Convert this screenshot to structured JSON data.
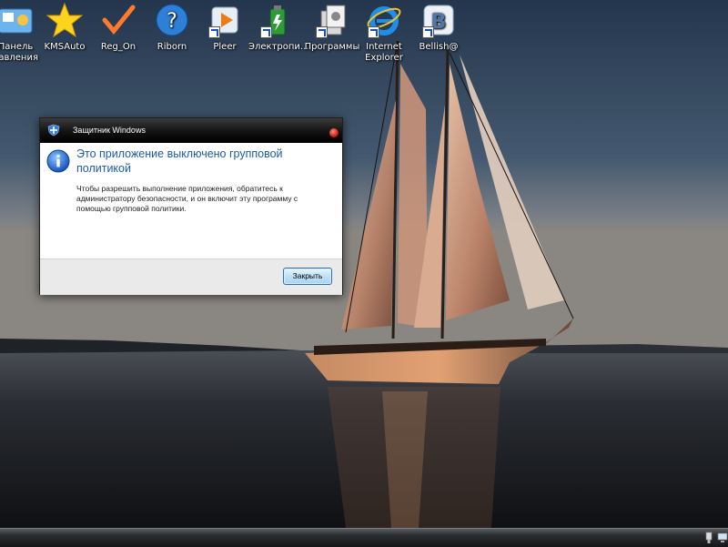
{
  "desktop": {
    "icons": [
      {
        "label": "Панель\nравления",
        "icon": "control-panel-icon"
      },
      {
        "label": "KMSAuto",
        "icon": "star-icon"
      },
      {
        "label": "Reg_On",
        "icon": "checkmark-icon"
      },
      {
        "label": "Riborn",
        "icon": "help-question-icon"
      },
      {
        "label": "Pleer",
        "icon": "media-player-icon"
      },
      {
        "label": "Электропи...",
        "icon": "battery-icon"
      },
      {
        "label": "Программы",
        "icon": "programs-icon"
      },
      {
        "label": "Internet\nExplorer",
        "icon": "internet-explorer-icon"
      },
      {
        "label": "Bellish@",
        "icon": "vk-icon"
      }
    ]
  },
  "dialog": {
    "title": "Защитник Windows",
    "heading": "Это приложение выключено групповой политикой",
    "body": "Чтобы разрешить выполнение приложения, обратитесь к администратору безопасности, и он включит эту программу с помощью групповой политики.",
    "close_button_label": "Закрыть"
  },
  "colors": {
    "heading_blue": "#1e5aa8",
    "titlebar_black": "#121212",
    "button_blue": "#a7d5f4",
    "close_red": "#c1140c"
  }
}
